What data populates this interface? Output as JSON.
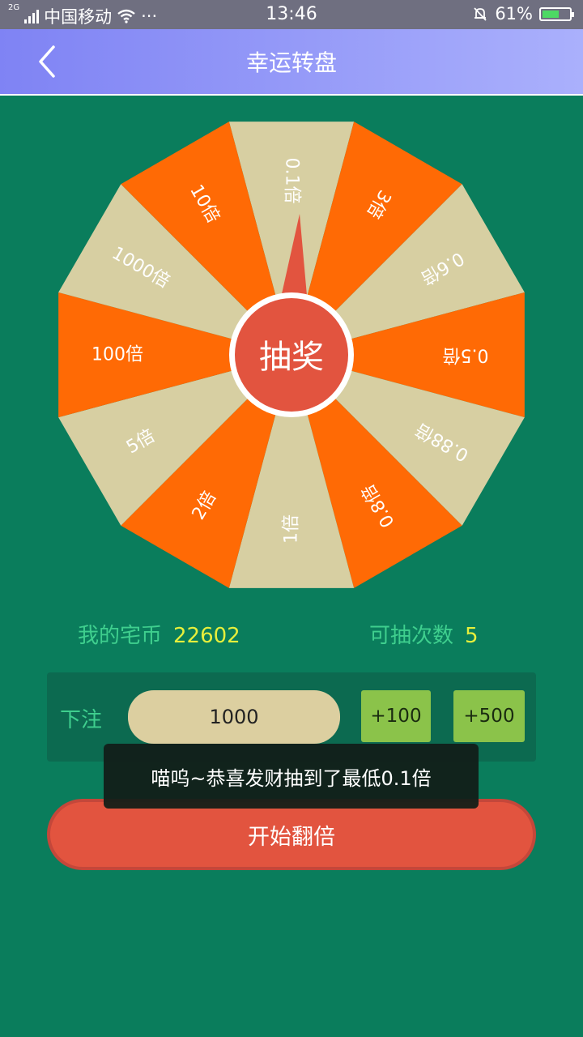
{
  "status_bar": {
    "network_type": "2G",
    "carrier": "中国移动",
    "more": "···",
    "time": "13:46",
    "battery": "61%",
    "battery_level": 0.61,
    "icons": [
      "signal-icon",
      "wifi-icon",
      "mute-bell-icon",
      "battery-icon"
    ]
  },
  "header": {
    "title": "幸运转盘",
    "back_icon": "chevron-left-icon"
  },
  "wheel": {
    "center_label": "抽奖",
    "segments": [
      "0.1倍",
      "3倍",
      "0.6倍",
      "0.5倍",
      "0.88倍",
      "0.8倍",
      "1倍",
      "2倍",
      "5倍",
      "100倍",
      "1000倍",
      "10倍"
    ],
    "colors": {
      "orange": "#ff6a05",
      "beige": "#d7cfa2",
      "button": "#e2543f",
      "pointer": "#e2543f"
    }
  },
  "stats": {
    "coins_label": "我的宅币",
    "coins_value": "22602",
    "draws_label": "可抽次数",
    "draws_value": "5"
  },
  "bet": {
    "label": "下注",
    "amount": "1000",
    "add100": "+100",
    "add500": "+500"
  },
  "toast": {
    "message": "喵呜~恭喜发财抽到了最低0.1倍"
  },
  "start_button": {
    "label": "开始翻倍"
  }
}
